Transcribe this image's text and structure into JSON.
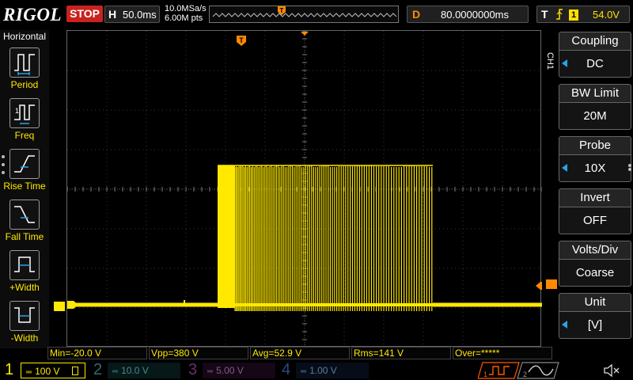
{
  "topbar": {
    "logo": "RIGOL",
    "run_state": "STOP",
    "horizontal": {
      "letter": "H",
      "timebase": "50.0ms"
    },
    "sample_rate": "10.0MSa/s",
    "memory_depth": "6.00M pts",
    "delay": {
      "letter": "D",
      "value": "80.0000000ms"
    },
    "trigger": {
      "letter": "T",
      "source": "1",
      "level": "54.0V"
    }
  },
  "left_menu": {
    "title": "Horizontal",
    "items": [
      {
        "icon": "period-icon",
        "label": "Period"
      },
      {
        "icon": "freq-icon",
        "label": "Freq"
      },
      {
        "icon": "rise-time-icon",
        "label": "Rise Time"
      },
      {
        "icon": "fall-time-icon",
        "label": "Fall Time"
      },
      {
        "icon": "positive-width-icon",
        "label": "+Width"
      },
      {
        "icon": "negative-width-icon",
        "label": "-Width"
      }
    ]
  },
  "right_menu": {
    "channel_tag": "CH1",
    "items": [
      {
        "title": "Coupling",
        "value": "DC",
        "arrow": true
      },
      {
        "title": "BW Limit",
        "value": "20M",
        "arrow": false
      },
      {
        "title": "Probe",
        "value": "10X",
        "arrow": true
      },
      {
        "title": "Invert",
        "value": "OFF",
        "arrow": false
      },
      {
        "title": "Volts/Div",
        "value": "Coarse",
        "arrow": false
      },
      {
        "title": "Unit",
        "value": "[V]",
        "arrow": true
      }
    ]
  },
  "measurements": {
    "min": "Min=-20.0 V",
    "vpp": "Vpp=380 V",
    "avg": "Avg=52.9 V",
    "rms": "Rms=141 V",
    "over": "Over=*****"
  },
  "channels": [
    {
      "num": "1",
      "scale": "100 V",
      "coupling": "DC",
      "active": true,
      "color": "#ffe900"
    },
    {
      "num": "2",
      "scale": "10.0 V",
      "coupling": "DC",
      "active": false,
      "color": "#00c8c8"
    },
    {
      "num": "3",
      "scale": "5.00 V",
      "coupling": "DC",
      "active": false,
      "color": "#d040d0"
    },
    {
      "num": "4",
      "scale": "1.00 V",
      "coupling": "DC",
      "active": false,
      "color": "#2a7ae0"
    }
  ],
  "markers": {
    "ch1_marker": "1",
    "trigger_marker": "T"
  },
  "math": {
    "slot1": "1",
    "slot2": "2"
  },
  "colors": {
    "ch1": "#ffe900",
    "trigger": "#ff8a00",
    "stop": "#c8231e",
    "accent": "#29a3e6"
  }
}
